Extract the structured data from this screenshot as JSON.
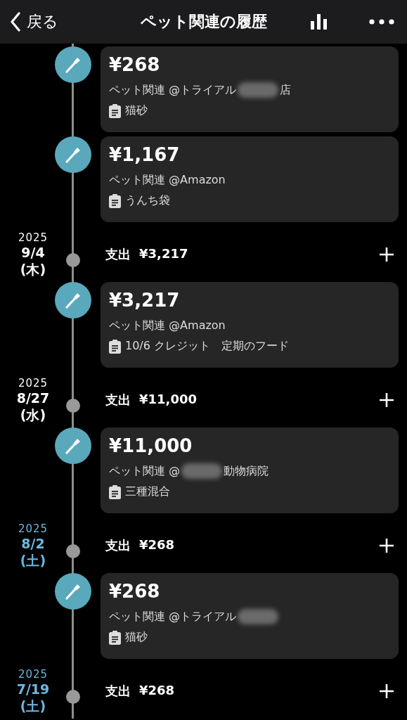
{
  "header": {
    "back_label": "戻る",
    "title": "ペット関連の履歴"
  },
  "timeline": [
    {
      "kind": "entry",
      "amount": "¥268",
      "category": "ペット関連",
      "store": "@トライアル",
      "redacted": true,
      "store_suffix": "店",
      "note": "猫砂"
    },
    {
      "kind": "entry",
      "amount": "¥1,167",
      "category": "ペット関連",
      "store": "@Amazon",
      "redacted": false,
      "note": "うんち袋"
    },
    {
      "kind": "day",
      "year": "2025",
      "date": "9/4",
      "weekday": "(木)",
      "color": "#ffffff",
      "label": "支出",
      "total": "¥3,217"
    },
    {
      "kind": "entry",
      "amount": "¥3,217",
      "category": "ペット関連",
      "store": "@Amazon",
      "redacted": false,
      "note": "10/6 クレジット　定期のフード"
    },
    {
      "kind": "day",
      "year": "2025",
      "date": "8/27",
      "weekday": "(水)",
      "color": "#ffffff",
      "label": "支出",
      "total": "¥11,000"
    },
    {
      "kind": "entry",
      "amount": "¥11,000",
      "category": "ペット関連",
      "store": "@",
      "redacted": true,
      "store_suffix": "動物病院",
      "note": "三種混合"
    },
    {
      "kind": "day",
      "year": "2025",
      "date": "8/2",
      "weekday": "(土)",
      "color": "#6cb7e0",
      "label": "支出",
      "total": "¥268"
    },
    {
      "kind": "entry",
      "amount": "¥268",
      "category": "ペット関連",
      "store": "@トライアル",
      "redacted": true,
      "note": "猫砂"
    },
    {
      "kind": "day",
      "year": "2025",
      "date": "7/19",
      "weekday": "(土)",
      "color": "#6cb7e0",
      "label": "支出",
      "total": "¥268"
    }
  ]
}
